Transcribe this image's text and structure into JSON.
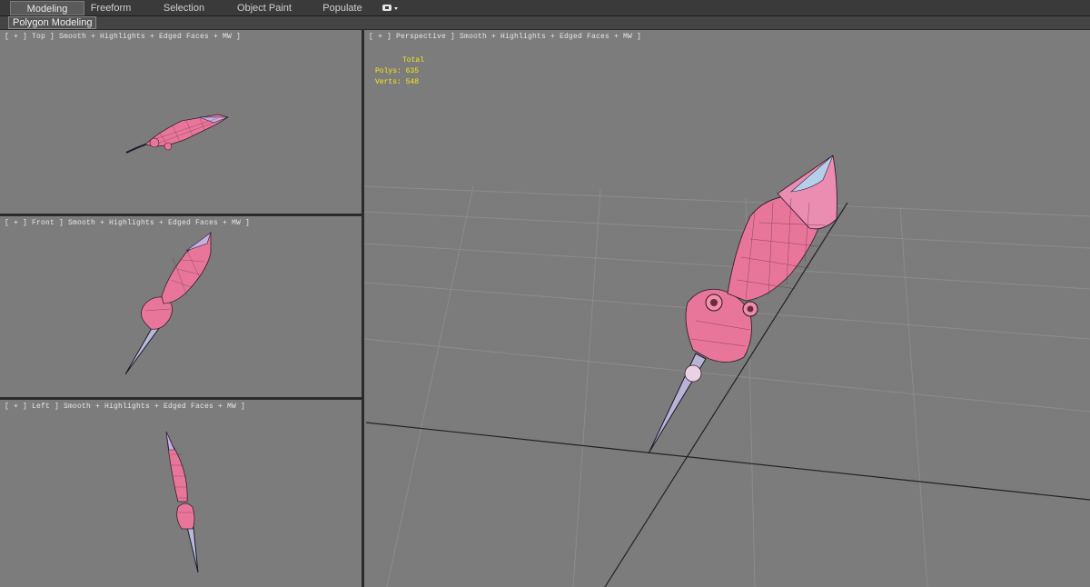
{
  "ribbon": {
    "tabs": [
      {
        "label": "Modeling"
      },
      {
        "label": "Freeform"
      },
      {
        "label": "Selection"
      },
      {
        "label": "Object Paint"
      },
      {
        "label": "Populate"
      }
    ],
    "active_tab": "Modeling",
    "sub_tab": "Polygon Modeling"
  },
  "viewports": {
    "top": {
      "label": "[ + ] Top ] Smooth + Highlights + Edged Faces + MW ]"
    },
    "front": {
      "label": "[ + ] Front ] Smooth + Highlights + Edged Faces + MW ]"
    },
    "left": {
      "label": "[ + ] Left ] Smooth + Highlights + Edged Faces + MW ]"
    },
    "perspective": {
      "label": "[ + ] Perspective ] Smooth + Highlights + Edged Faces + MW ]"
    }
  },
  "stats": {
    "total_label": "Total",
    "polys": "Polys: 635",
    "verts": "Verts: 548"
  },
  "colors": {
    "viewport_bg": "#7c7c7c",
    "model_pink": "#e8769a",
    "stats_yellow": "#f6e81c"
  }
}
